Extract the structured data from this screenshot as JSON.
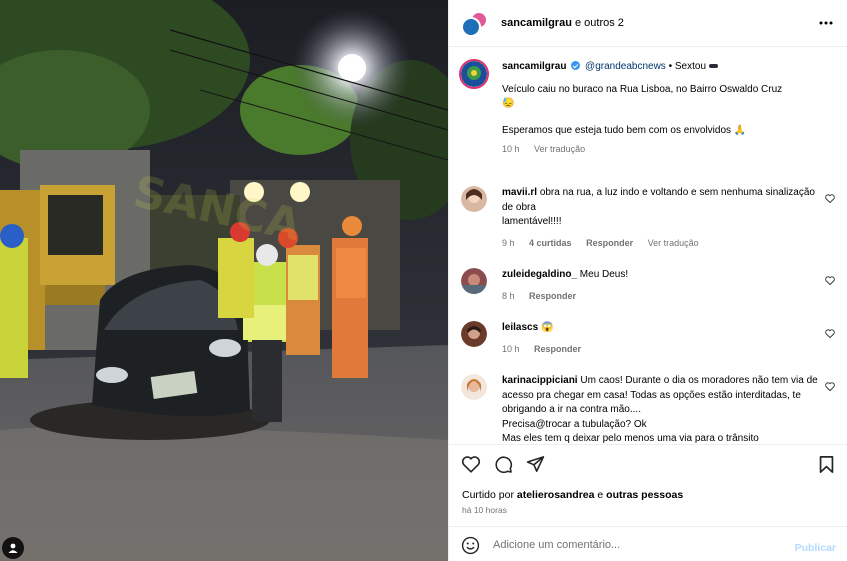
{
  "header": {
    "title_user": "sancamilgrau",
    "title_rest": " e outros 2"
  },
  "caption": {
    "username": "sancamilgrau",
    "mention": "@grandeabcnews",
    "suffix": " • Sextou ",
    "line1": "Veículo caiu no buraco na Rua Lisboa, no Bairro Oswaldo Cruz",
    "emoji1": "😓",
    "line2": "Esperamos que esteja tudo bem com os envolvidos",
    "emoji2": "🙏",
    "time": "10 h",
    "translate": "Ver tradução"
  },
  "comments": [
    {
      "username": "mavii.rl",
      "text": "obra na rua, a luz indo e voltando e sem nenhuma sinalização de obra",
      "text2": "lamentável!!!!",
      "time": "9 h",
      "likes": "4 curtidas",
      "reply": "Responder",
      "translate": "Ver tradução"
    },
    {
      "username": "zuleidegaldino_",
      "text": "Meu Deus!",
      "time": "8 h",
      "reply": "Responder"
    },
    {
      "username": "leilascs",
      "text": "😱",
      "time": "10 h",
      "reply": "Responder"
    },
    {
      "username": "karinacippiciani",
      "text": "Um caos! Durante o dia os moradores não tem via de acesso pra chegar em casa! Todas as opções estão interditadas, te obrigando a ir na contra mão....",
      "text2": "Precisa@trocar a tubulação? Ok",
      "text3": "Mas eles tem q deixar pelo menos uma via para o trânsito"
    }
  ],
  "footer": {
    "liked_prefix": "Curtido por ",
    "liked_user": "atelierosandrea",
    "liked_mid": " e ",
    "liked_others": "outras pessoas",
    "time": "há 10 horas"
  },
  "comment_box": {
    "placeholder": "Adicione um comentário...",
    "publish": "Publicar"
  },
  "photo": {
    "watermark": "SANCA"
  },
  "colors": {
    "mention": "#00376b",
    "meta": "#737373",
    "publish_disabled": "#b3dbff",
    "verified": "#3897f0"
  }
}
